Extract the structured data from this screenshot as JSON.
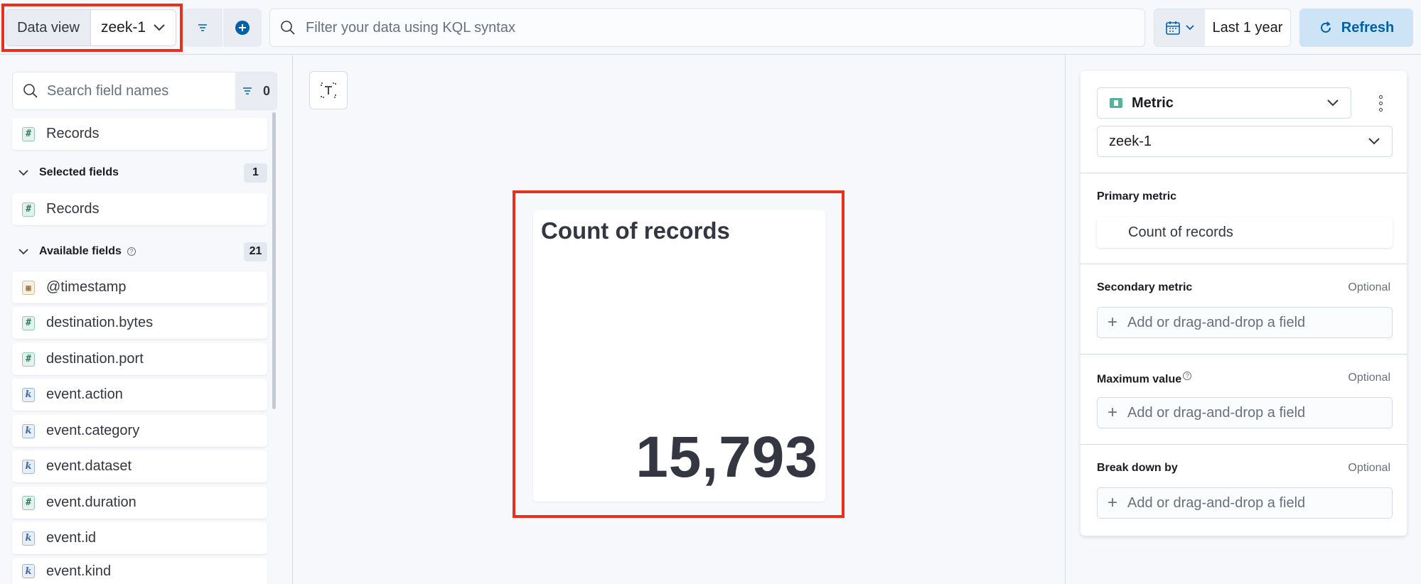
{
  "topbar": {
    "data_view_label": "Data view",
    "data_view_value": "zeek-1",
    "query_placeholder": "Filter your data using KQL syntax",
    "time_range": "Last 1 year",
    "refresh_label": "Refresh"
  },
  "field_list": {
    "search_placeholder": "Search field names",
    "filter_count": "0",
    "records_top": "Records",
    "selected_header": "Selected fields",
    "selected_count": "1",
    "selected_items": [
      {
        "name": "Records",
        "type": "number"
      }
    ],
    "available_header": "Available fields",
    "available_count": "21",
    "available_items": [
      {
        "name": "@timestamp",
        "type": "date"
      },
      {
        "name": "destination.bytes",
        "type": "number"
      },
      {
        "name": "destination.port",
        "type": "number"
      },
      {
        "name": "event.action",
        "type": "keyword"
      },
      {
        "name": "event.category",
        "type": "keyword"
      },
      {
        "name": "event.dataset",
        "type": "keyword"
      },
      {
        "name": "event.duration",
        "type": "number"
      },
      {
        "name": "event.id",
        "type": "keyword"
      },
      {
        "name": "event.kind",
        "type": "keyword"
      }
    ],
    "type_tokens": {
      "number": "#",
      "keyword": "k",
      "date": "▦"
    }
  },
  "visualization": {
    "title": "Count of records",
    "value": "15,793"
  },
  "config": {
    "vis_type": "Metric",
    "data_view": "zeek-1",
    "primary_label": "Primary metric",
    "primary_value": "Count of records",
    "secondary_label": "Secondary metric",
    "max_label": "Maximum value",
    "breakdown_label": "Break down by",
    "optional": "Optional",
    "add_field": "Add or drag-and-drop a field"
  },
  "colors": {
    "accent": "#0061a6",
    "highlight": "#e8301c",
    "refresh_bg": "#cce4f5"
  }
}
